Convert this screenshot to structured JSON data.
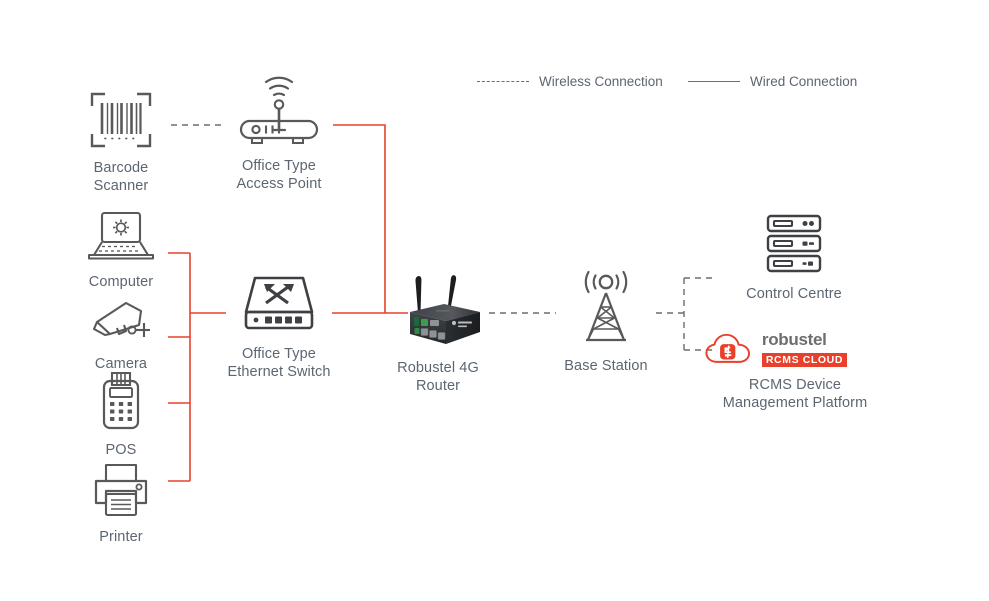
{
  "legend": {
    "wireless": {
      "label": "Wireless Connection",
      "style": "dashed",
      "color": "#6d6d6d"
    },
    "wired": {
      "label": "Wired Connection",
      "style": "solid",
      "color": "#e8402a"
    }
  },
  "colors": {
    "text": "#5c6672",
    "icon_stroke": "#58595b",
    "wired": "#e8402a",
    "wireless": "#6d6d6d",
    "brand_red": "#e8402a",
    "background": "#ffffff"
  },
  "nodes": [
    {
      "id": "barcode-scanner",
      "label": "Barcode\nScanner",
      "icon": "barcode-scanner-icon"
    },
    {
      "id": "access-point",
      "label": "Office Type\nAccess Point",
      "icon": "wireless-access-point-icon"
    },
    {
      "id": "computer",
      "label": "Computer",
      "icon": "laptop-computer-icon"
    },
    {
      "id": "camera",
      "label": "Camera",
      "icon": "cctv-camera-icon"
    },
    {
      "id": "pos",
      "label": "POS",
      "icon": "pos-terminal-icon"
    },
    {
      "id": "printer",
      "label": "Printer",
      "icon": "printer-icon"
    },
    {
      "id": "ethernet-switch",
      "label": "Office Type\nEthernet Switch",
      "icon": "ethernet-switch-icon"
    },
    {
      "id": "router",
      "label": "Robustel 4G\nRouter",
      "icon": "robustel-4g-router-icon"
    },
    {
      "id": "base-station",
      "label": "Base Station",
      "icon": "cell-tower-icon"
    },
    {
      "id": "control-centre",
      "label": "Control Centre",
      "icon": "server-rack-icon"
    },
    {
      "id": "rcms",
      "label": "RCMS Device\nManagement Platform",
      "icon": "rcms-cloud-logo-icon"
    }
  ],
  "rcms_logo": {
    "wordmark": "robustel",
    "badge": "RCMS CLOUD"
  },
  "connections": [
    {
      "from": "barcode-scanner",
      "to": "access-point",
      "type": "wireless"
    },
    {
      "from": "access-point",
      "to": "router",
      "type": "wired"
    },
    {
      "from": "computer",
      "to": "ethernet-switch",
      "type": "wired"
    },
    {
      "from": "camera",
      "to": "ethernet-switch",
      "type": "wired"
    },
    {
      "from": "pos",
      "to": "ethernet-switch",
      "type": "wired"
    },
    {
      "from": "printer",
      "to": "ethernet-switch",
      "type": "wired"
    },
    {
      "from": "ethernet-switch",
      "to": "router",
      "type": "wired"
    },
    {
      "from": "router",
      "to": "base-station",
      "type": "wireless"
    },
    {
      "from": "base-station",
      "to": "control-centre",
      "type": "wireless"
    },
    {
      "from": "base-station",
      "to": "rcms",
      "type": "wireless"
    }
  ]
}
